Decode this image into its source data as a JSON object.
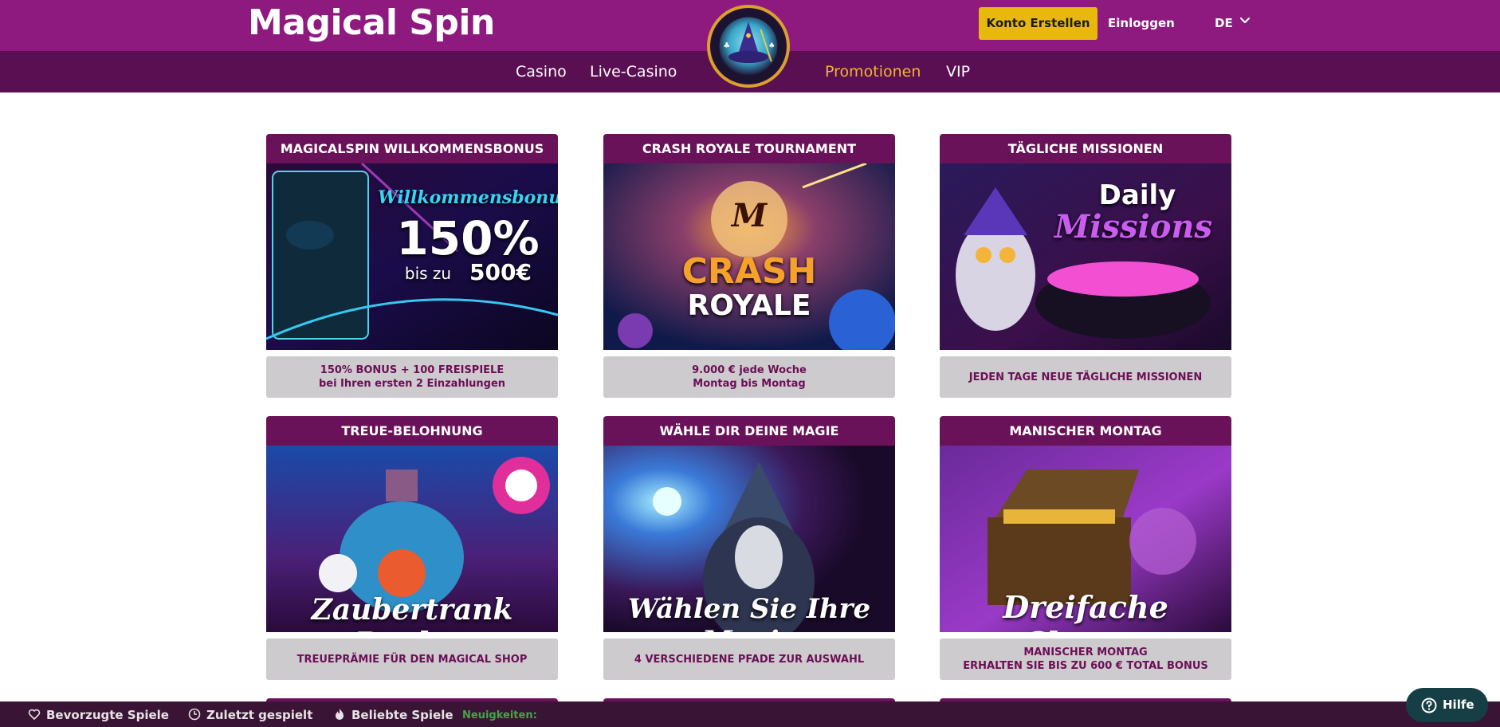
{
  "header": {
    "brand": "Magical Spin",
    "register_label": "Konto Erstellen",
    "login_label": "Einloggen",
    "language": "DE",
    "accent_color": "#8e1a80",
    "button_color": "#e8b90c"
  },
  "nav": {
    "items": [
      {
        "label": "Casino",
        "active": false
      },
      {
        "label": "Live-Casino",
        "active": false
      },
      {
        "label": "Promotionen",
        "active": true
      },
      {
        "label": "VIP",
        "active": false
      }
    ]
  },
  "promotions": [
    {
      "title": "MAGICALSPIN WILLKOMMENSBONUS",
      "image_text": [
        "Willkommensbonus",
        "150%",
        "bis zu",
        "500€"
      ],
      "description": [
        "150% BONUS + 100 FREISPIELE",
        "bei Ihren ersten 2 Einzahlungen"
      ]
    },
    {
      "title": "CRASH ROYALE TOURNAMENT",
      "image_text": [
        "M",
        "CRASH",
        "ROYALE"
      ],
      "description": [
        "9.000 € jede Woche",
        "Montag bis Montag"
      ]
    },
    {
      "title": "TÄGLICHE MISSIONEN",
      "image_text": [
        "Daily",
        "Missions"
      ],
      "description": [
        "JEDEN TAGE NEUE TÄGLICHE MISSIONEN"
      ]
    },
    {
      "title": "TREUE-BELOHNUNG",
      "image_text": [
        "Zaubertrank Punkte"
      ],
      "description": [
        "TREUEPRÄMIE FÜR DEN MAGICAL SHOP"
      ]
    },
    {
      "title": "WÄHLE DIR DEINE MAGIE",
      "image_text": [
        "Wählen Sie Ihre Magie"
      ],
      "description": [
        "4 VERSCHIEDENE PFADE ZUR AUSWAHL"
      ]
    },
    {
      "title": "MANISCHER MONTAG",
      "image_text": [
        "Dreifache Chance"
      ],
      "description": [
        "MANISCHER MONTAG",
        "ERHALTEN SIE BIS ZU 600 € TOTAL BONUS"
      ]
    }
  ],
  "bottombar": {
    "favorites_label": "Bevorzugte Spiele",
    "recent_label": "Zuletzt gespielt",
    "popular_label": "Beliebte Spiele",
    "news_label": "Neuigkeiten:"
  },
  "help": {
    "label": "Hilfe"
  },
  "icons": [
    "chevron-down-icon",
    "heart-icon",
    "clock-icon",
    "flame-icon",
    "question-icon"
  ]
}
